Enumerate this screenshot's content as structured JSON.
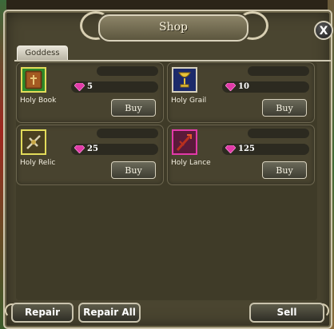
{
  "window": {
    "title": "Shop",
    "close_label": "X"
  },
  "tabs": [
    {
      "label": "Goddess"
    }
  ],
  "items": [
    {
      "name": "Holy Book",
      "price": "5",
      "buy_label": "Buy",
      "icon": "holy-book-icon",
      "frame_color": "#2f8a2a"
    },
    {
      "name": "Holy Grail",
      "price": "10",
      "buy_label": "Buy",
      "icon": "holy-grail-icon",
      "frame_color": "#2a3f8a"
    },
    {
      "name": "Holy Relic",
      "price": "25",
      "buy_label": "Buy",
      "icon": "holy-relic-icon",
      "frame_color": "#7a6a2a"
    },
    {
      "name": "Holy Lance",
      "price": "125",
      "buy_label": "Buy",
      "icon": "holy-lance-icon",
      "frame_color": "#b21a6b"
    }
  ],
  "currency_icon": "pink-gem-icon",
  "footer": {
    "repair_label": "Repair",
    "repair_all_label": "Repair All",
    "sell_label": "Sell"
  }
}
